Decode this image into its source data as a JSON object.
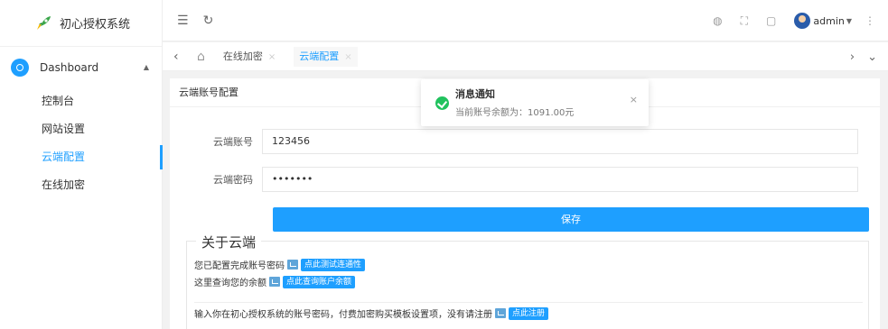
{
  "app": {
    "title": "初心授权系统"
  },
  "sidebar": {
    "group_label": "Dashboard",
    "items": [
      {
        "label": "控制台"
      },
      {
        "label": "网站设置"
      },
      {
        "label": "云端配置"
      },
      {
        "label": "在线加密"
      }
    ],
    "active_index": 2
  },
  "header": {
    "username": "admin",
    "icons": [
      "menu-toggle-icon",
      "refresh-icon",
      "globe-icon",
      "fullscreen-icon",
      "lock-icon",
      "more-icon"
    ]
  },
  "tabs": {
    "items": [
      {
        "label": "在线加密"
      },
      {
        "label": "云端配置"
      }
    ],
    "active_index": 1,
    "close_glyph": "×"
  },
  "card": {
    "title": "云端账号配置"
  },
  "form": {
    "account_label": "云端账号",
    "account_value": "123456",
    "password_label": "云端密码",
    "password_value": "•••••••",
    "save_label": "保存"
  },
  "about": {
    "legend": "关于云端",
    "line1_text": "您已配置完成账号密码",
    "line1_button": "点此测试连通性",
    "line2_text": "这里查询您的余额",
    "line2_button": "点此查询账户余额",
    "line3_text": "输入你在初心授权系统的账号密码，付费加密购买模板设置项，没有请注册",
    "line3_button": "点此注册"
  },
  "notification": {
    "title": "消息通知",
    "message": "当前账号余额为：1091.00元",
    "status": "success"
  },
  "colors": {
    "accent": "#1e9fff",
    "success": "#21c25e"
  }
}
